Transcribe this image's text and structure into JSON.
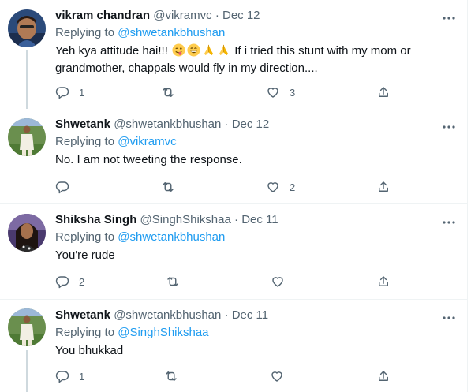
{
  "tweets": [
    {
      "name": "vikram chandran",
      "handle": "@vikramvc",
      "date": "Dec 12",
      "replying_label": "Replying to",
      "replying_to": "@shwetankbhushan",
      "text_start": "Yeh kya attitude hai!!!",
      "emojis": [
        "winking-face-with-tongue-emoji",
        "grinning-face-emoji",
        "folded-hands-emoji",
        "folded-hands-emoji"
      ],
      "text_end": " If i tried this stunt with my mom or grandmother, chappals would fly in my direction....",
      "reply_count": "1",
      "retweet_count": "",
      "like_count": "3"
    },
    {
      "name": "Shwetank",
      "handle": "@shwetankbhushan",
      "date": "Dec 12",
      "replying_label": "Replying to",
      "replying_to": "@vikramvc",
      "text": "No. I am not tweeting the response.",
      "reply_count": "",
      "retweet_count": "",
      "like_count": "2"
    },
    {
      "name": "Shiksha Singh",
      "handle": "@SinghShikshaa",
      "date": "Dec 11",
      "replying_label": "Replying to",
      "replying_to": "@shwetankbhushan",
      "text": "You're rude",
      "reply_count": "2",
      "retweet_count": "",
      "like_count": ""
    },
    {
      "name": "Shwetank",
      "handle": "@shwetankbhushan",
      "date": "Dec 11",
      "replying_label": "Replying to",
      "replying_to": "@SinghShikshaa",
      "text": "You bhukkad",
      "reply_count": "1",
      "retweet_count": "",
      "like_count": ""
    }
  ],
  "separator": "·",
  "colors": {
    "text": "#0f1419",
    "secondary": "#536471",
    "link": "#1d9bf0",
    "border": "#eff3f4",
    "thread_line": "#cfd9de"
  },
  "icons": [
    "more-icon",
    "reply-icon",
    "retweet-icon",
    "like-icon",
    "share-icon"
  ]
}
